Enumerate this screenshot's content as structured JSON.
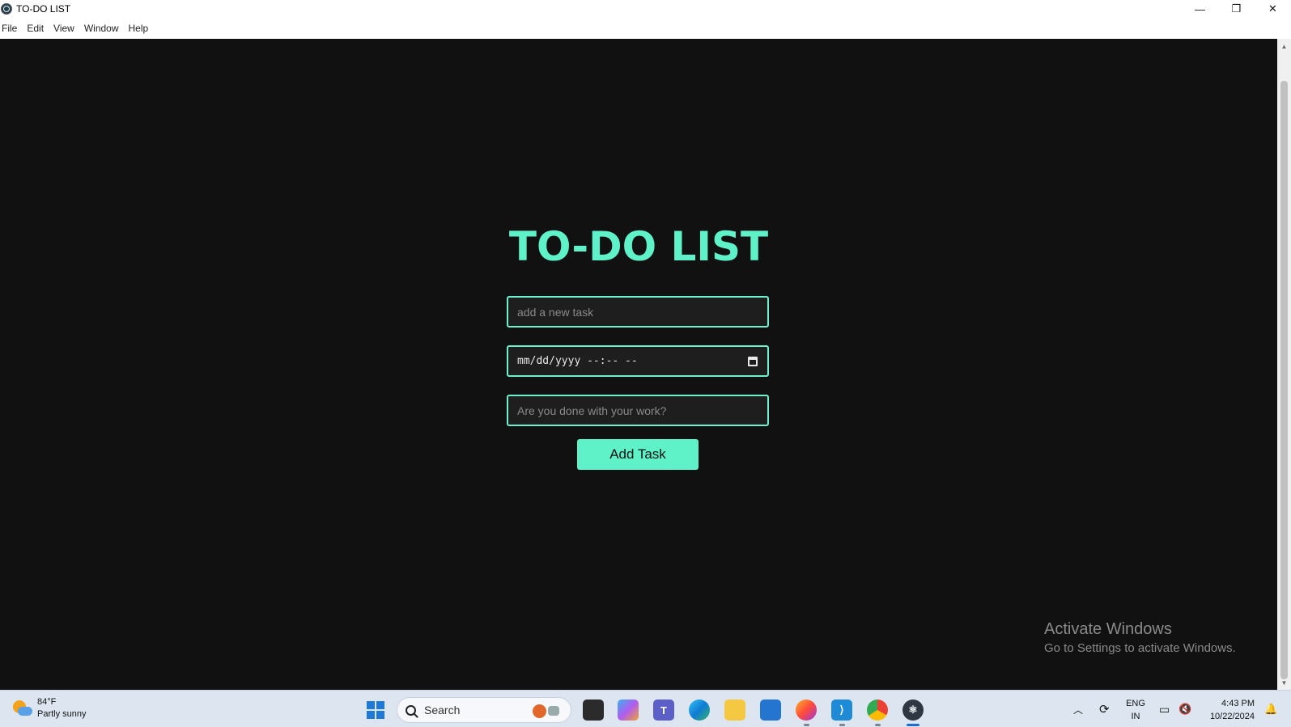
{
  "window": {
    "title": "TO-DO LIST",
    "minimize": "—",
    "maximize": "❐",
    "close": "✕"
  },
  "menu": [
    "File",
    "Edit",
    "View",
    "Window",
    "Help"
  ],
  "app": {
    "heading": "TO-DO LIST",
    "task_placeholder": "add a new task",
    "datetime_display": "mm/dd/yyyy  --:-- --",
    "done_placeholder": "Are you done with your work?",
    "add_button": "Add Task",
    "accent_color": "#5ff2c8"
  },
  "watermark": {
    "line1": "Activate Windows",
    "line2": "Go to Settings to activate Windows."
  },
  "taskbar": {
    "weather_temp": "84°F",
    "weather_desc": "Partly sunny",
    "search_label": "Search",
    "lang_top": "ENG",
    "lang_bottom": "IN",
    "time": "4:43 PM",
    "date": "10/22/2024",
    "apps": [
      "file-manager",
      "copilot",
      "teams",
      "edge",
      "file-explorer",
      "store",
      "firefox",
      "vscode",
      "chrome",
      "electron"
    ]
  }
}
